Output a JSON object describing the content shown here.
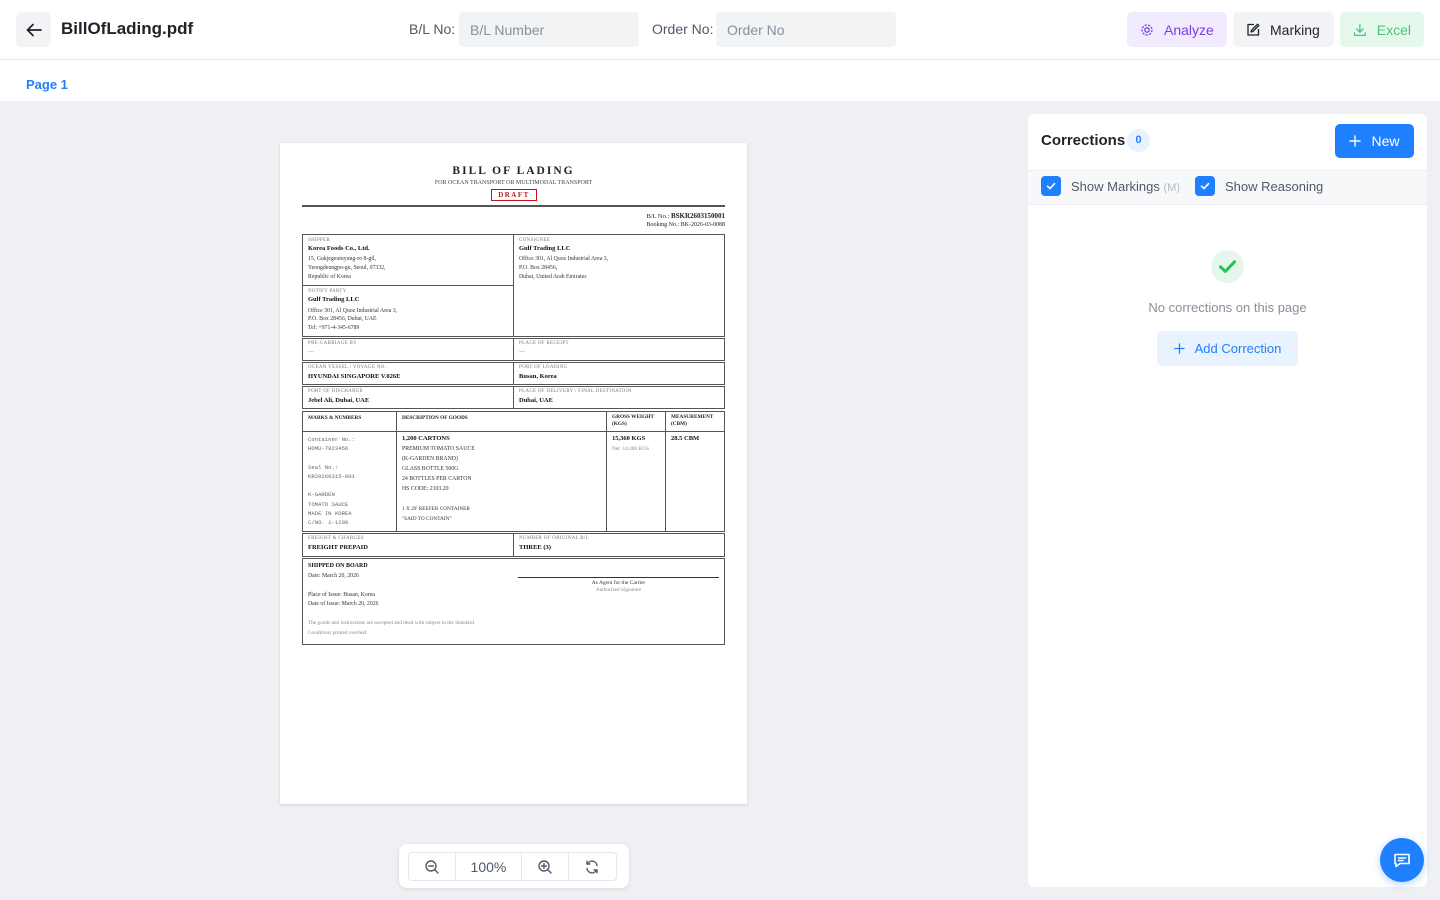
{
  "header": {
    "file_name": "BillOfLading.pdf",
    "bl_label": "B/L No:",
    "bl_placeholder": "B/L Number",
    "bl_value": "",
    "order_label": "Order No:",
    "order_placeholder": "Order No",
    "order_value": "",
    "analyze_label": "Analyze",
    "marking_label": "Marking",
    "excel_label": "Excel"
  },
  "tabs": {
    "page1": "Page 1"
  },
  "document": {
    "title": "BILL OF LADING",
    "subtitle": "FOR OCEAN TRANSPORT OR MULTIMODAL TRANSPORT",
    "draft": "DRAFT",
    "bl_no_label": "B/L No.:",
    "bl_no": "BSKR2603150001",
    "booking": "Booking No.: BK-2026-03-0088",
    "shipper": {
      "label": "SHIPPER",
      "name": "Korea Foods Co., Ltd.",
      "line1": "15, Gukjegeumyung-ro 8-gil,",
      "line2": "Yeongdeungpo-gu, Seoul, 07332,",
      "line3": "Republic of Korea"
    },
    "consignee": {
      "label": "CONSIGNEE",
      "name": "Gulf Trading LLC",
      "line1": "Office 301, Al Quoz Industrial Area 3,",
      "line2": "P.O. Box 28456,",
      "line3": "Dubai, United Arab Emirates"
    },
    "notify": {
      "label": "NOTIFY PARTY",
      "name": "Gulf Trading LLC",
      "line1": "Office 301, Al Quoz Industrial Area 3,",
      "line2": "P.O. Box 28456, Dubai, UAE",
      "line3": "Tel: +971-4-345-6789"
    },
    "pre_carriage": {
      "label": "PRE-CARRIAGE BY",
      "value": "—"
    },
    "place_receipt": {
      "label": "PLACE OF RECEIPT",
      "value": "—"
    },
    "vessel": {
      "label": "OCEAN VESSEL / VOYAGE NO.",
      "value": "HYUNDAI SINGAPORE V.026E"
    },
    "port_loading": {
      "label": "PORT OF LOADING",
      "value": "Busan, Korea"
    },
    "port_discharge": {
      "label": "PORT OF DISCHARGE",
      "value": "Jebel Ali, Dubai, UAE"
    },
    "place_delivery": {
      "label": "PLACE OF DELIVERY / FINAL DESTINATION",
      "value": "Dubai, UAE"
    },
    "goods_headers": {
      "marks": "MARKS & NUMBERS",
      "desc": "DESCRIPTION OF GOODS",
      "gross1": "GROSS WEIGHT",
      "gross2": "(KGS)",
      "meas1": "MEASUREMENT",
      "meas2": "(CBM)"
    },
    "marks": {
      "l1": "Container No.:",
      "l2": "HDMU-7823456",
      "l3": "Seal No.:",
      "l4": "KR20260315-001",
      "l5": "K-GARDEN",
      "l6": "TOMATO SAUCE",
      "l7": "MADE IN KOREA",
      "l8": "C/NO. 1-1200"
    },
    "goods": {
      "l1": "1,200 CARTONS",
      "l2": "PREMIUM TOMATO SAUCE",
      "l3": "(K-GARDEN BRAND)",
      "l4": "GLASS BOTTLE 500G",
      "l5": "24 BOTTLES PER CARTON",
      "l6": "HS CODE: 2103.20",
      "l7": "1 X 20' REEFER CONTAINER",
      "l8": "\"SAID TO CONTAIN\""
    },
    "gross": "15,360 KGS",
    "net": "Net: 14,400 KGS",
    "measure": "28.5 CBM",
    "freight": {
      "label": "FREIGHT & CHARGES",
      "value": "FREIGHT PREPAID"
    },
    "originals": {
      "label": "NUMBER OF ORIGINAL B/L",
      "value": "THREE (3)"
    },
    "shipped_on_board": "SHIPPED ON BOARD",
    "shipped_date": "Date: March 20, 2026",
    "place_issue": "Place of Issue: Busan, Korea",
    "date_issue": "Date of Issue: March 20, 2026",
    "terms1": "The goods and instructions are accepted and dealt with subject to the Standard",
    "terms2": "Conditions printed overleaf.",
    "agent": "As Agent for the Carrier",
    "auth_sig": "Authorized Signature"
  },
  "zoom": {
    "level": "100%"
  },
  "corrections": {
    "title": "Corrections",
    "count": "0",
    "new_label": "New",
    "show_markings": "Show Markings",
    "markings_shortcut": "(M)",
    "show_reasoning": "Show Reasoning",
    "empty_text": "No corrections on this page",
    "add_label": "Add Correction"
  },
  "colors": {
    "accent": "#1e80ff",
    "analyze": "#7a3ee8",
    "excel": "#4cc27a",
    "draft_red": "#c0151b"
  },
  "icons": {
    "back": "arrow-left-icon",
    "analyze": "gear-icon",
    "marking": "edit-icon",
    "excel": "download-icon",
    "zoom_out": "zoom-out-icon",
    "zoom_in": "zoom-in-icon",
    "reset": "refresh-icon",
    "check": "check-circle-icon",
    "chat": "chat-icon"
  }
}
